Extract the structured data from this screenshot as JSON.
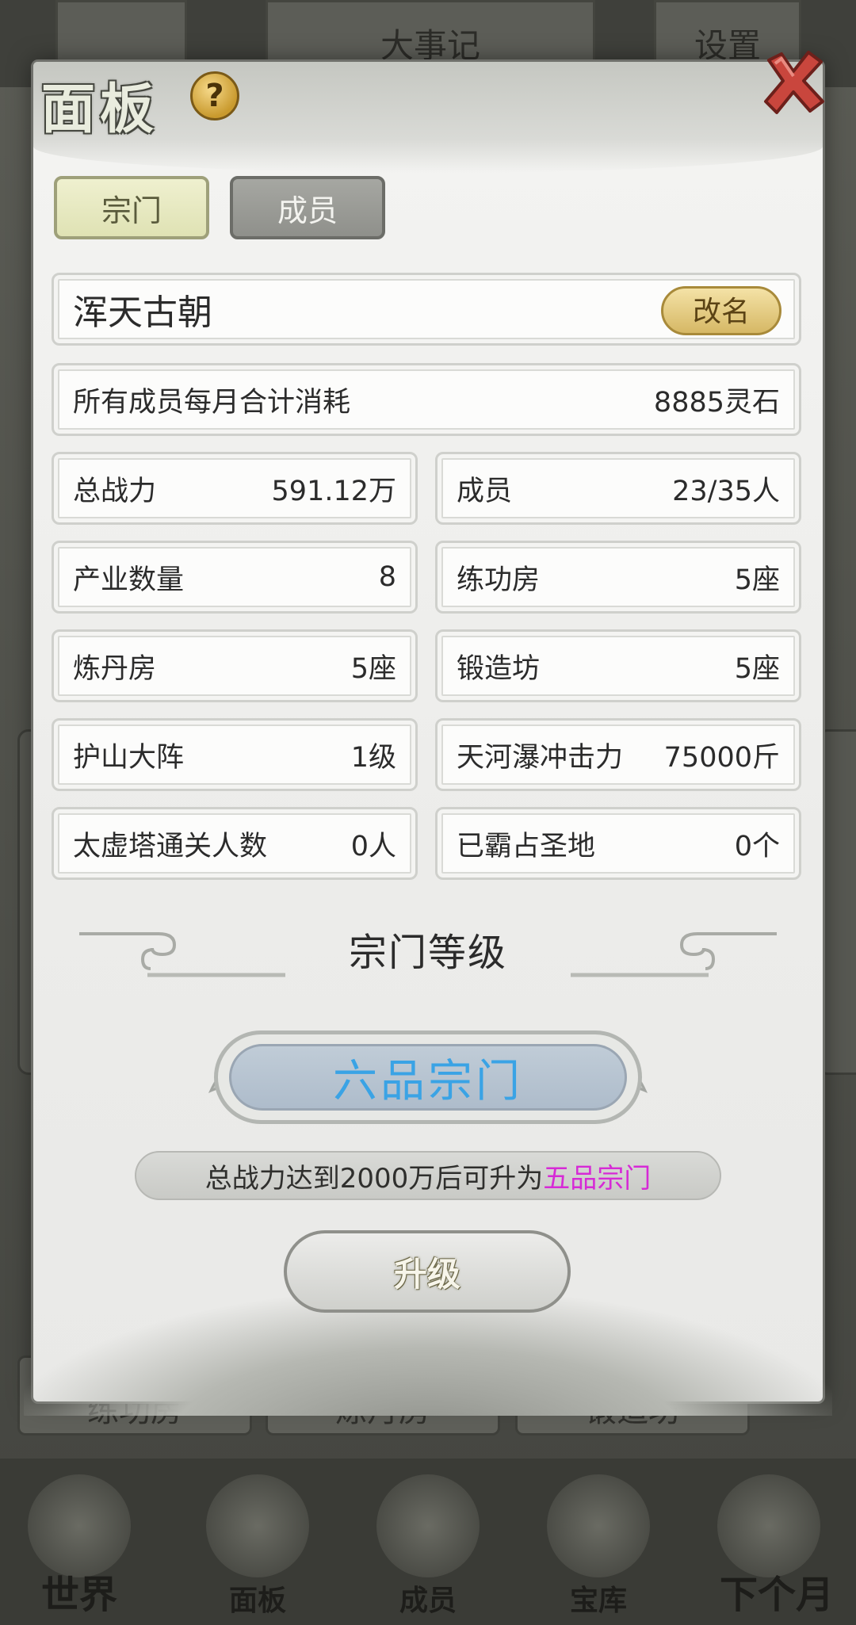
{
  "background": {
    "top_buttons": [
      "",
      "大事记",
      "设置"
    ],
    "bottom_rows": [
      "练功房",
      "炼丹房",
      "锻造坊"
    ],
    "nav": [
      "世界",
      "面板",
      "成员",
      "宝库",
      "下个月"
    ]
  },
  "panel": {
    "title": "面板",
    "help_icon_text": "?",
    "tabs": [
      {
        "label": "宗门",
        "active": true
      },
      {
        "label": "成员",
        "active": false
      }
    ],
    "sect_name": "浑天古朝",
    "rename_label": "改名",
    "monthly_cost": {
      "label": "所有成员每月合计消耗",
      "value": "8885灵石"
    },
    "stats": [
      {
        "label": "总战力",
        "value": "591.12万"
      },
      {
        "label": "成员",
        "value": "23/35人"
      },
      {
        "label": "产业数量",
        "value": "8"
      },
      {
        "label": "练功房",
        "value": "5座"
      },
      {
        "label": "炼丹房",
        "value": "5座"
      },
      {
        "label": "锻造坊",
        "value": "5座"
      },
      {
        "label": "护山大阵",
        "value": "1级"
      },
      {
        "label": "天河瀑冲击力",
        "value": "75000斤"
      },
      {
        "label": "太虚塔通关人数",
        "value": "0人"
      },
      {
        "label": "已霸占圣地",
        "value": "0个"
      }
    ],
    "level_heading": "宗门等级",
    "current_rank": "六品宗门",
    "hint_prefix": "总战力达到2000万后可升为",
    "hint_target": "五品宗门",
    "upgrade_label": "升级"
  },
  "colors": {
    "rank_text": "#3aa3e5",
    "hint_highlight": "#d62ad6",
    "rename_gold": "#d6b865",
    "active_tab": "#dfe2b4"
  }
}
